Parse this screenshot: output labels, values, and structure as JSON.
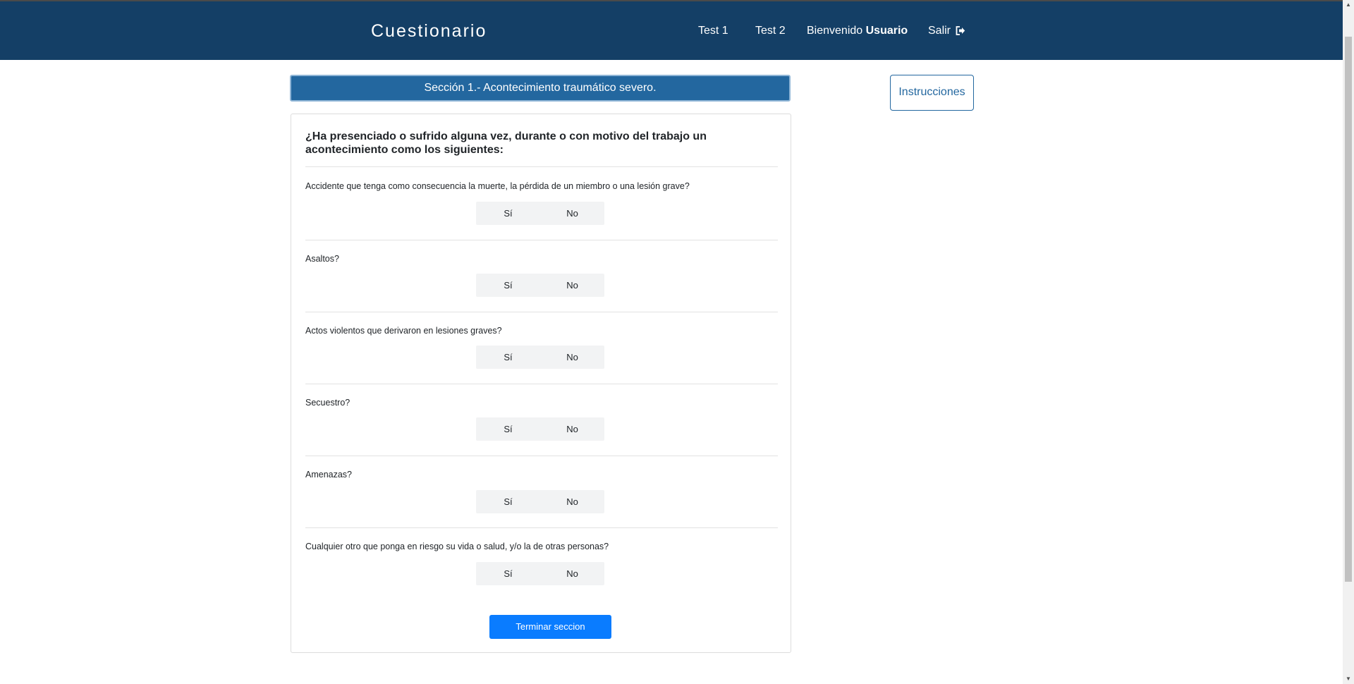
{
  "navbar": {
    "brand": "Cuestionario",
    "links": {
      "test1": "Test 1",
      "test2": "Test 2",
      "welcome_prefix": "Bienvenido",
      "welcome_user": "Usuario",
      "logout": "Salir"
    },
    "logout_icon": "sign-out-icon"
  },
  "section": {
    "title": "Sección 1.- Acontecimiento traumático severo."
  },
  "instructions_button": "Instrucciones",
  "card": {
    "prompt": "¿Ha presenciado o sufrido alguna vez, durante o con motivo del trabajo un acontecimiento como los siguientes:",
    "options": {
      "yes": "Sí",
      "no": "No"
    },
    "questions": [
      "Accidente que tenga como consecuencia la muerte, la pérdida de un miembro o una lesión grave?",
      "Asaltos?",
      "Actos violentos que derivaron en lesiones graves?",
      "Secuestro?",
      "Amenazas?",
      "Cualquier otro que ponga en riesgo su vida o salud, y/o la de otras personas?"
    ],
    "finish_button": "Terminar seccion"
  },
  "colors": {
    "navbar_bg": "#143f66",
    "section_header_bg": "#23679f",
    "primary_button": "#0a7cff"
  }
}
